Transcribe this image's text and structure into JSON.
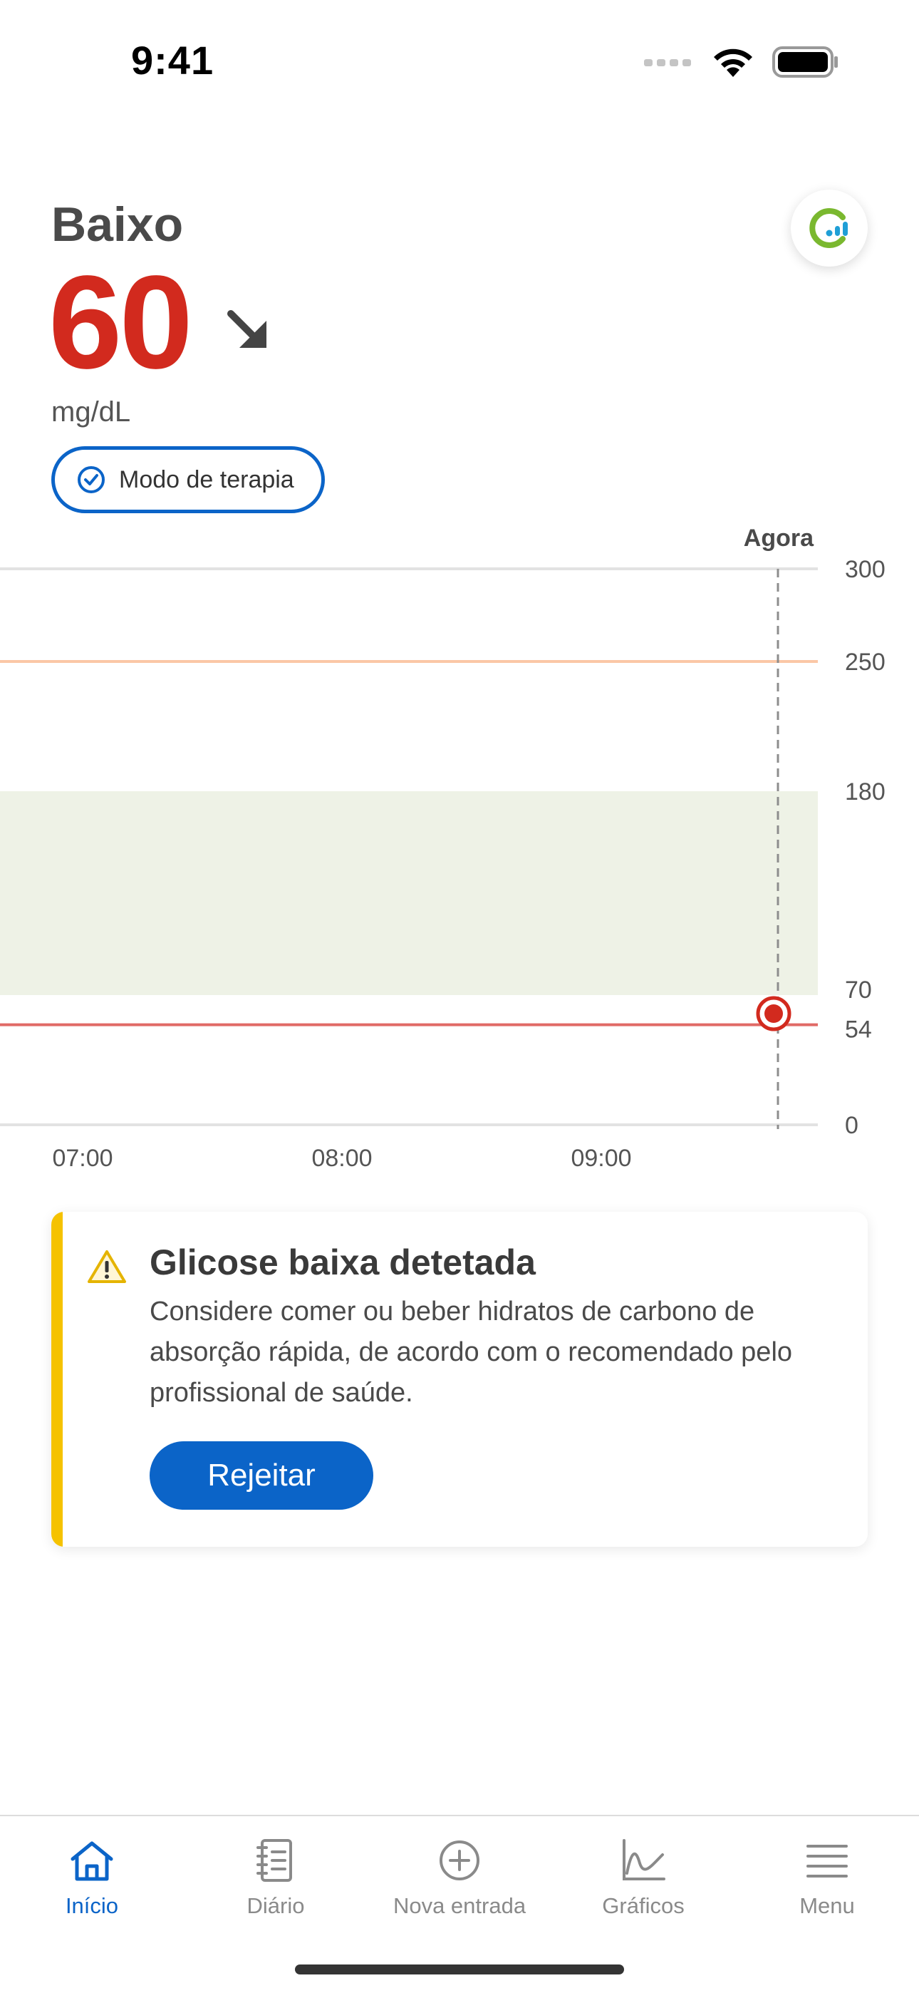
{
  "status_bar": {
    "time": "9:41"
  },
  "header": {
    "status": "Baixo",
    "glucose_value": "60",
    "unit": "mg/dL",
    "therapy_mode_label": "Modo de terapia",
    "accent_color": "#d22a1e",
    "trend_icon": "arrow-down-right-icon",
    "brand_icon": "sensor-logo-icon"
  },
  "chart_data": {
    "type": "line",
    "now_label": "Agora",
    "x_tick_labels": [
      "07:00",
      "08:00",
      "09:00"
    ],
    "y_tick_labels": [
      "300",
      "250",
      "180",
      "70",
      "54",
      "0"
    ],
    "ylim": [
      0,
      300
    ],
    "target_range": [
      70,
      180
    ],
    "high_threshold": 250,
    "low_threshold": 54,
    "current_point": {
      "time": "09:41",
      "value": 60
    },
    "colors": {
      "high_line": "#fbc7a6",
      "low_line": "#e06a66",
      "target_band": "#eef2e6",
      "point": "#d22a1e"
    }
  },
  "alert": {
    "title": "Glicose baixa detetada",
    "message": "Considere comer ou beber hidratos de carbono de absorção rápida, de acordo com o recomendado pelo profissional de saúde.",
    "dismiss_label": "Rejeitar",
    "icon": "warning-icon",
    "accent_color": "#f5c200"
  },
  "tab_bar": {
    "tabs": [
      {
        "label": "Início",
        "icon": "home-icon",
        "active": true
      },
      {
        "label": "Diário",
        "icon": "journal-icon",
        "active": false
      },
      {
        "label": "Nova entrada",
        "icon": "add-circle-icon",
        "active": false
      },
      {
        "label": "Gráficos",
        "icon": "chart-icon",
        "active": false
      },
      {
        "label": "Menu",
        "icon": "menu-icon",
        "active": false
      }
    ],
    "active_color": "#0b64c8"
  }
}
